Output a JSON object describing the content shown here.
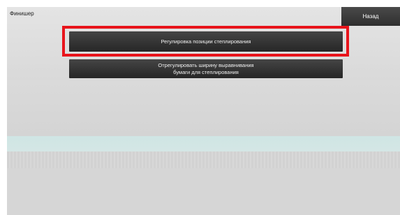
{
  "header": {
    "title": "Финишер",
    "back_label": "Назад"
  },
  "menu": {
    "items": [
      {
        "label": "Регулировка позиции степлирования"
      },
      {
        "label": "Отрегулировать ширину выравнивания\nбумаги для степлирования"
      }
    ]
  },
  "colors": {
    "highlight": "#e8141b",
    "button": "#333333",
    "background": "#dcdcdc"
  }
}
